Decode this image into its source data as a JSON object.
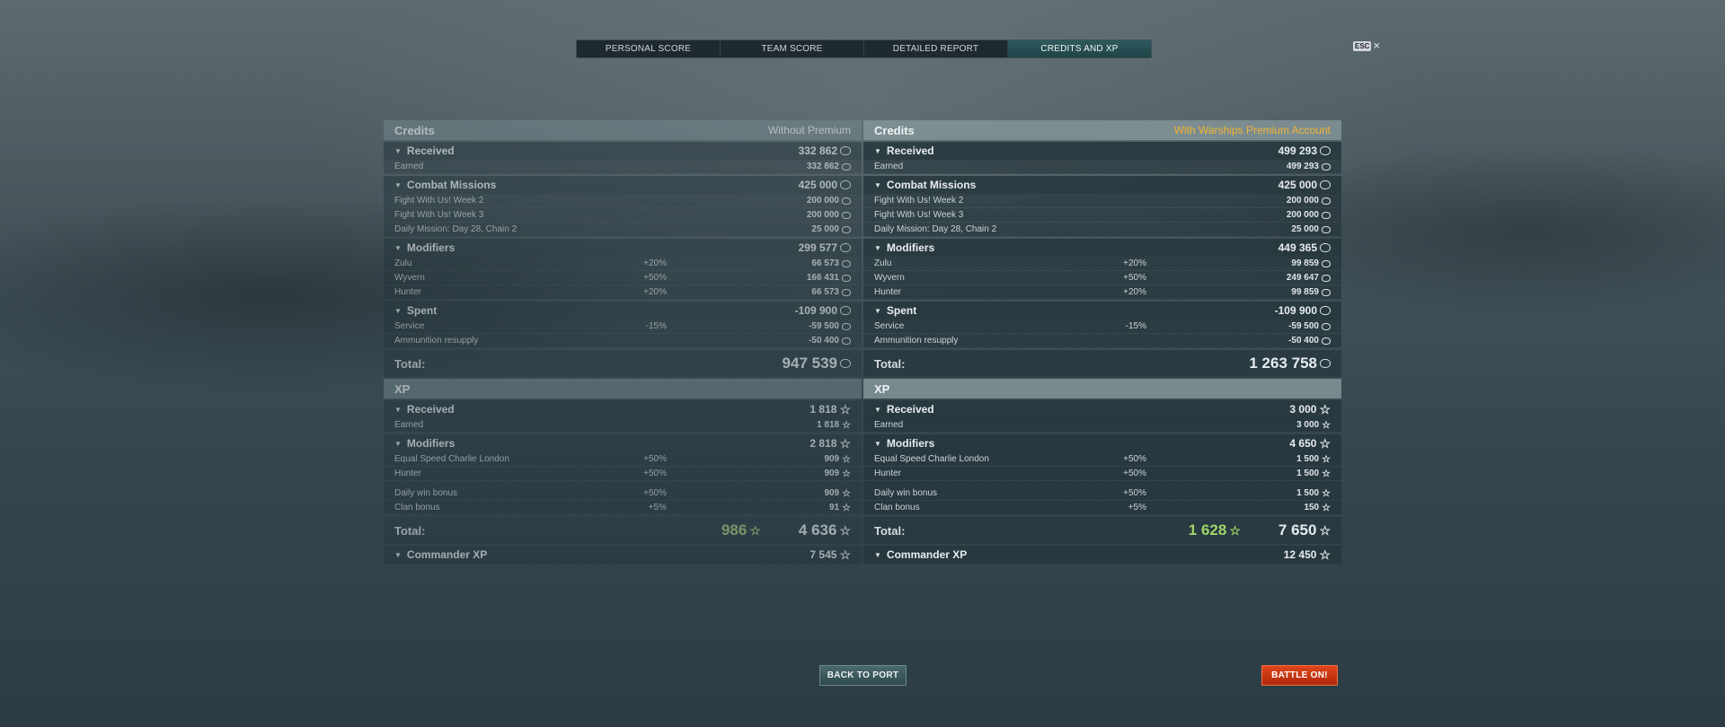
{
  "tabs": [
    "PERSONAL SCORE",
    "TEAM SCORE",
    "DETAILED REPORT",
    "CREDITS AND XP"
  ],
  "esc": {
    "key": "ESC",
    "close": "×"
  },
  "left": {
    "credits_title": "Credits",
    "credits_subtitle": "Without Premium",
    "received": {
      "label": "Received",
      "value": "332 862"
    },
    "earned": {
      "label": "Earned",
      "value": "332 862"
    },
    "combat": {
      "label": "Combat Missions",
      "value": "425 000"
    },
    "combat_items": [
      {
        "name": "Fight With Us! Week 2",
        "value": "200 000"
      },
      {
        "name": "Fight With Us! Week 3",
        "value": "200 000"
      },
      {
        "name": "Daily Mission: Day 28, Chain 2",
        "value": "25 000"
      }
    ],
    "modifiers": {
      "label": "Modifiers",
      "value": "299 577"
    },
    "modifier_items": [
      {
        "name": "Zulu",
        "pct": "+20%",
        "value": "66 573"
      },
      {
        "name": "Wyvern",
        "pct": "+50%",
        "value": "166 431"
      },
      {
        "name": "Hunter",
        "pct": "+20%",
        "value": "66 573"
      }
    ],
    "spent": {
      "label": "Spent",
      "value": "-109 900"
    },
    "spent_items": [
      {
        "name": "Service",
        "pct": "-15%",
        "value": "-59 500"
      },
      {
        "name": "Ammunition resupply",
        "pct": "",
        "value": "-50 400"
      }
    ],
    "credits_total": {
      "label": "Total:",
      "value": "947 539"
    },
    "xp_title": "XP",
    "xp_received": {
      "label": "Received",
      "value": "1 818"
    },
    "xp_earned": {
      "label": "Earned",
      "value": "1 818"
    },
    "xp_modifiers": {
      "label": "Modifiers",
      "value": "2 818"
    },
    "xp_modifier_items": [
      {
        "name": "Equal Speed Charlie London",
        "pct": "+50%",
        "value": "909"
      },
      {
        "name": "Hunter",
        "pct": "+50%",
        "value": "909"
      }
    ],
    "xp_bonus_items": [
      {
        "name": "Daily win bonus",
        "pct": "+50%",
        "value": "909"
      },
      {
        "name": "Clan bonus",
        "pct": "+5%",
        "value": "91"
      }
    ],
    "xp_total": {
      "label": "Total:",
      "free": "986",
      "value": "4 636"
    },
    "commander": {
      "label": "Commander XP",
      "value": "7 545"
    }
  },
  "right": {
    "credits_title": "Credits",
    "credits_subtitle": "With Warships Premium Account",
    "received": {
      "label": "Received",
      "value": "499 293"
    },
    "earned": {
      "label": "Earned",
      "value": "499 293"
    },
    "combat": {
      "label": "Combat Missions",
      "value": "425 000"
    },
    "combat_items": [
      {
        "name": "Fight With Us! Week 2",
        "value": "200 000"
      },
      {
        "name": "Fight With Us! Week 3",
        "value": "200 000"
      },
      {
        "name": "Daily Mission: Day 28, Chain 2",
        "value": "25 000"
      }
    ],
    "modifiers": {
      "label": "Modifiers",
      "value": "449 365"
    },
    "modifier_items": [
      {
        "name": "Zulu",
        "pct": "+20%",
        "value": "99 859"
      },
      {
        "name": "Wyvern",
        "pct": "+50%",
        "value": "249 647"
      },
      {
        "name": "Hunter",
        "pct": "+20%",
        "value": "99 859"
      }
    ],
    "spent": {
      "label": "Spent",
      "value": "-109 900"
    },
    "spent_items": [
      {
        "name": "Service",
        "pct": "-15%",
        "value": "-59 500"
      },
      {
        "name": "Ammunition resupply",
        "pct": "",
        "value": "-50 400"
      }
    ],
    "credits_total": {
      "label": "Total:",
      "value": "1 263 758"
    },
    "xp_title": "XP",
    "xp_received": {
      "label": "Received",
      "value": "3 000"
    },
    "xp_earned": {
      "label": "Earned",
      "value": "3 000"
    },
    "xp_modifiers": {
      "label": "Modifiers",
      "value": "4 650"
    },
    "xp_modifier_items": [
      {
        "name": "Equal Speed Charlie London",
        "pct": "+50%",
        "value": "1 500"
      },
      {
        "name": "Hunter",
        "pct": "+50%",
        "value": "1 500"
      }
    ],
    "xp_bonus_items": [
      {
        "name": "Daily win bonus",
        "pct": "+50%",
        "value": "1 500"
      },
      {
        "name": "Clan bonus",
        "pct": "+5%",
        "value": "150"
      }
    ],
    "xp_total": {
      "label": "Total:",
      "free": "1 628",
      "value": "7 650"
    },
    "commander": {
      "label": "Commander XP",
      "value": "12 450"
    }
  },
  "buttons": {
    "back": "BACK TO PORT",
    "battle": "BATTLE ON!"
  },
  "colors": {
    "premium_label": "#f0b435",
    "free_xp": "#9fd56a",
    "battle_button": "#c8320f",
    "active_tab": "#2a5256"
  }
}
